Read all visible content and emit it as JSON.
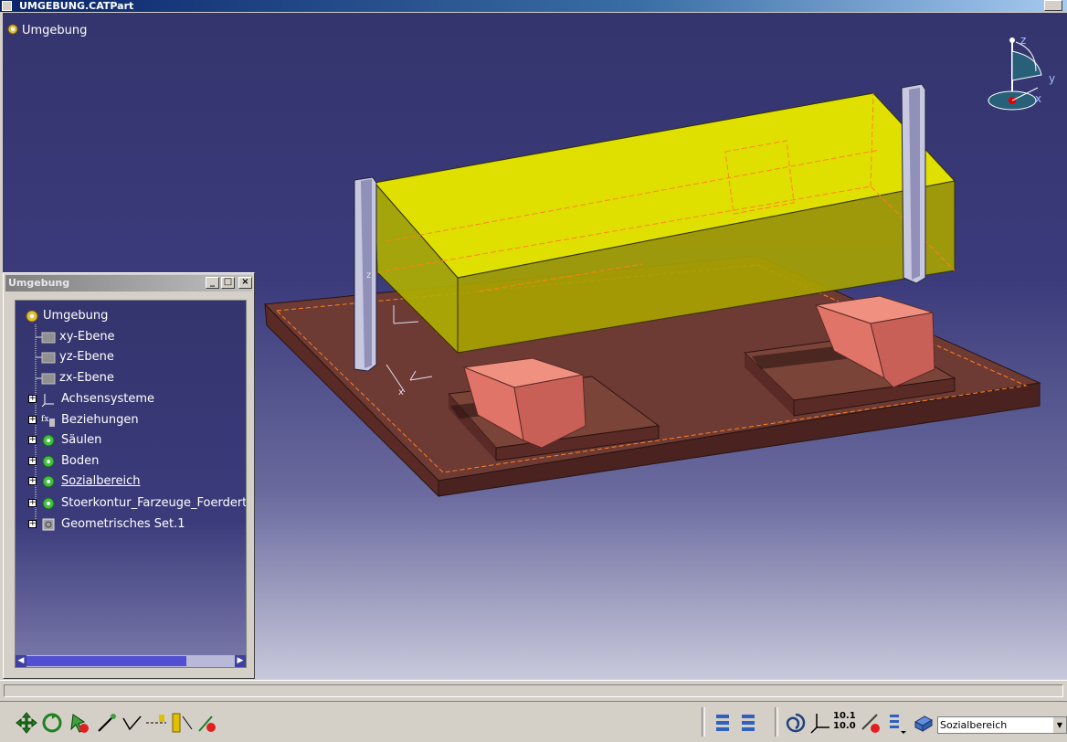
{
  "window": {
    "title": "UMGEBUNG.CATPart"
  },
  "viewport": {
    "root_label": "Umgebung",
    "compass_axes": {
      "z": "z",
      "y": "y",
      "x": "x"
    }
  },
  "tree_window": {
    "title": "Umgebung",
    "items": [
      {
        "label": "Umgebung",
        "icon": "part-gear-icon"
      },
      {
        "label": "xy-Ebene",
        "icon": "plane-icon"
      },
      {
        "label": "yz-Ebene",
        "icon": "plane-icon"
      },
      {
        "label": "zx-Ebene",
        "icon": "plane-icon"
      },
      {
        "label": "Achsensysteme",
        "icon": "axis-system-icon"
      },
      {
        "label": "Beziehungen",
        "icon": "relations-fx-icon"
      },
      {
        "label": "Säulen",
        "icon": "body-gear-icon"
      },
      {
        "label": "Boden",
        "icon": "body-gear-icon"
      },
      {
        "label": "Sozialbereich",
        "icon": "body-gear-icon",
        "selected": true
      },
      {
        "label": "Stoerkontur_Farzeuge_Foerdertechnik",
        "icon": "body-gear-icon"
      },
      {
        "label": "Geometrisches Set.1",
        "icon": "geometric-set-icon"
      }
    ]
  },
  "toolbar": {
    "current_body": "Sozialbereich",
    "measure_values": {
      "top": "10.1",
      "bottom": "10.0"
    }
  },
  "colors": {
    "background_top": "#34346e",
    "background_bottom": "#c8c8dc",
    "yellow_body": "#e0e000",
    "floor_slab": "#6e3a34",
    "salmon_blocks": "#e88278",
    "hidden_edges": "#ff8020"
  }
}
